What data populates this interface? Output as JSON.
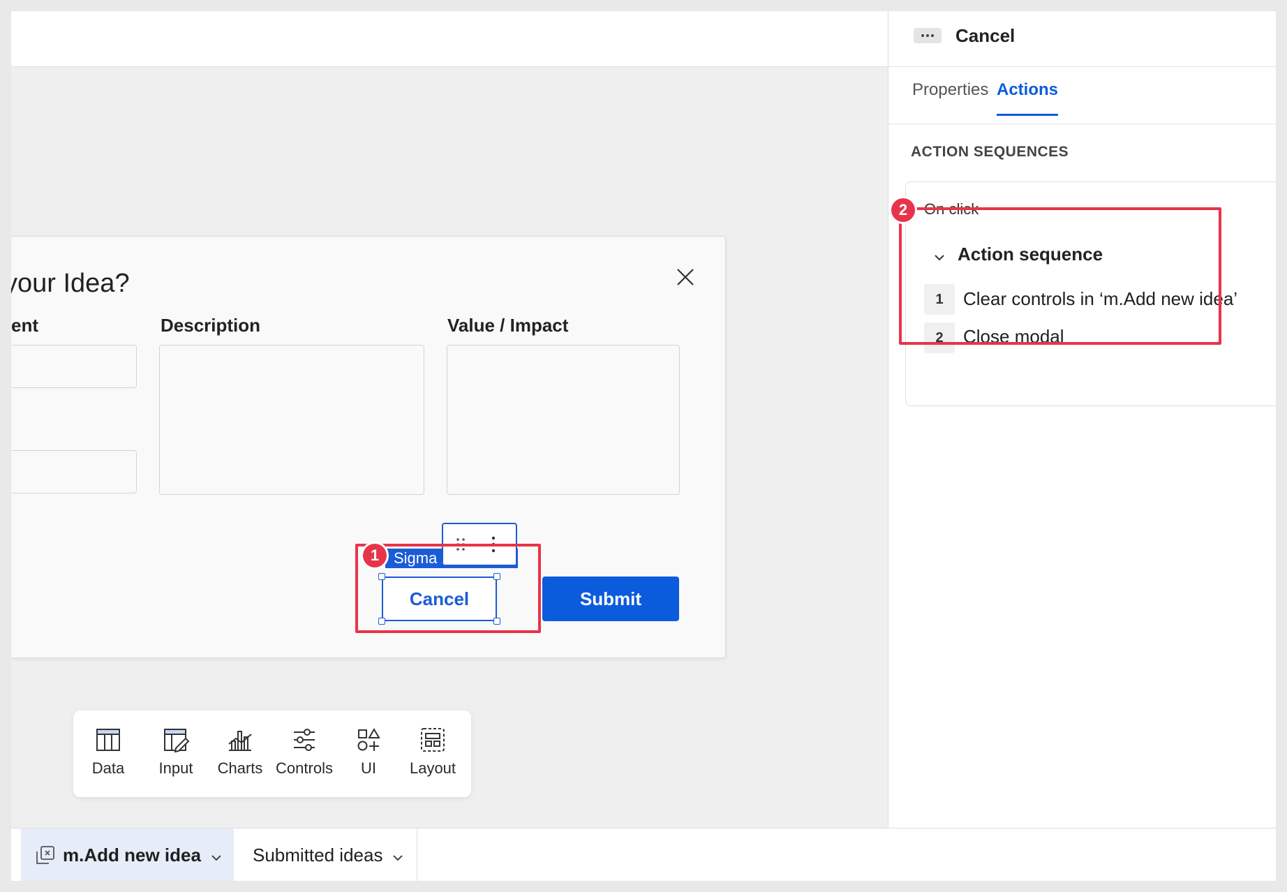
{
  "modal": {
    "title": "your Idea?",
    "fields": [
      {
        "label": "ent"
      },
      {
        "label": "Description"
      },
      {
        "label": "Value / Impact"
      }
    ],
    "cancel_label": "Cancel",
    "submit_label": "Submit",
    "element_tag": "Sigma /"
  },
  "annotations": {
    "badge1": "1",
    "badge2": "2"
  },
  "palette": {
    "items": [
      {
        "label": "Data",
        "icon": "table-icon"
      },
      {
        "label": "Input",
        "icon": "input-table-icon"
      },
      {
        "label": "Charts",
        "icon": "charts-icon"
      },
      {
        "label": "Controls",
        "icon": "sliders-icon"
      },
      {
        "label": "UI",
        "icon": "shapes-icon"
      },
      {
        "label": "Layout",
        "icon": "layout-icon"
      }
    ]
  },
  "pages": {
    "tabs": [
      {
        "label": "m.Add new idea",
        "active": true
      },
      {
        "label": "Submitted ideas",
        "active": false
      }
    ]
  },
  "panel": {
    "title": "Cancel",
    "tabs": [
      {
        "label": "Properties",
        "active": false
      },
      {
        "label": "Actions",
        "active": true
      }
    ],
    "section_label": "ACTION SEQUENCES",
    "trigger": "On click",
    "sequence_title": "Action sequence",
    "steps": [
      {
        "num": "1",
        "text": "Clear controls in ‘m.Add new idea’"
      },
      {
        "num": "2",
        "text": "Close modal"
      }
    ]
  },
  "colors": {
    "accent": "#0b5bdd",
    "annotation": "#e8344a"
  }
}
